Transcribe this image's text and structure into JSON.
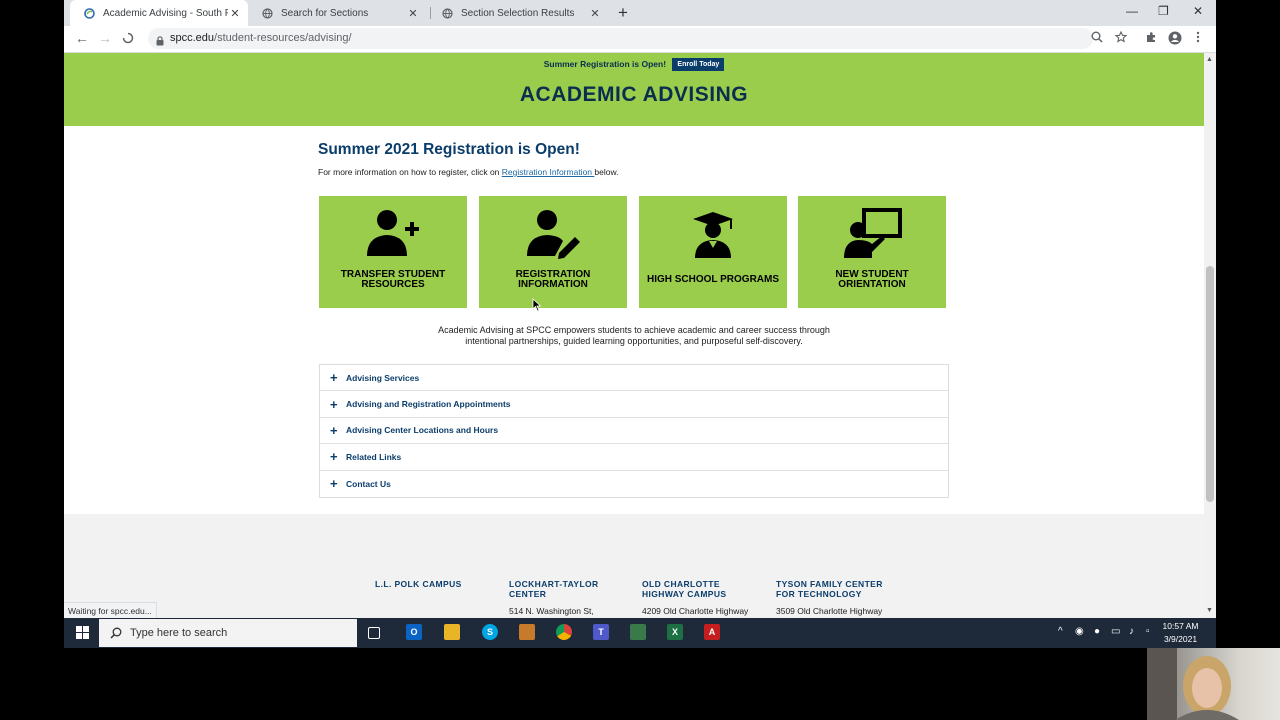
{
  "browser": {
    "tabs": [
      {
        "title": "Academic Advising - South Piedm",
        "close": "✕"
      },
      {
        "title": "Search for Sections",
        "close": "✕"
      },
      {
        "title": "Section Selection Results",
        "close": "✕"
      }
    ],
    "new_tab": "+",
    "window": {
      "minimize": "—",
      "restore": "❐",
      "close": "✕"
    },
    "url_domain": "spcc.edu",
    "url_path": "/student-resources/advising/",
    "status": "Waiting for spcc.edu..."
  },
  "banner": {
    "announcement": "Summer Registration is Open!",
    "enroll_label": "Enroll Today",
    "title": "ACADEMIC ADVISING"
  },
  "main": {
    "heading": "Summer 2021 Registration is Open!",
    "intro_before": "For more information on how to register, click on ",
    "intro_link": "Registration Information ",
    "intro_after": "below.",
    "cards": [
      {
        "line1": "TRANSFER STUDENT",
        "line2": "RESOURCES",
        "icon": "person-add-icon"
      },
      {
        "line1": "REGISTRATION",
        "line2": "INFORMATION",
        "icon": "person-edit-icon"
      },
      {
        "line1": "HIGH SCHOOL PROGRAMS",
        "line2": "",
        "icon": "graduate-icon"
      },
      {
        "line1": "NEW STUDENT",
        "line2": "ORIENTATION",
        "icon": "presenter-icon"
      }
    ],
    "mission_line1": "Academic Advising at SPCC empowers students to achieve academic and career success through",
    "mission_line2": "intentional partnerships, guided learning opportunities, and purposeful self-discovery.",
    "accordion": [
      "Advising Services",
      "Advising and Registration Appointments",
      "Advising Center Locations and Hours",
      "Related Links",
      "Contact Us"
    ]
  },
  "footer": {
    "campuses": [
      {
        "name1": "L.L. POLK CAMPUS",
        "name2": "",
        "address": ""
      },
      {
        "name1": "LOCKHART-TAYLOR",
        "name2": "CENTER",
        "address": "514 N. Washington St,"
      },
      {
        "name1": "OLD CHARLOTTE",
        "name2": "HIGHWAY CAMPUS",
        "address": "4209 Old Charlotte Highway"
      },
      {
        "name1": "TYSON FAMILY CENTER",
        "name2": "FOR TECHNOLOGY",
        "address": "3509 Old Charlotte Highway"
      }
    ]
  },
  "taskbar": {
    "search_placeholder": "Type here to search",
    "time": "10:57 AM",
    "date": "3/9/2021"
  },
  "colors": {
    "green": "#9acd4c",
    "navy": "#0b3d6b",
    "taskbar": "#1e2a3a"
  }
}
